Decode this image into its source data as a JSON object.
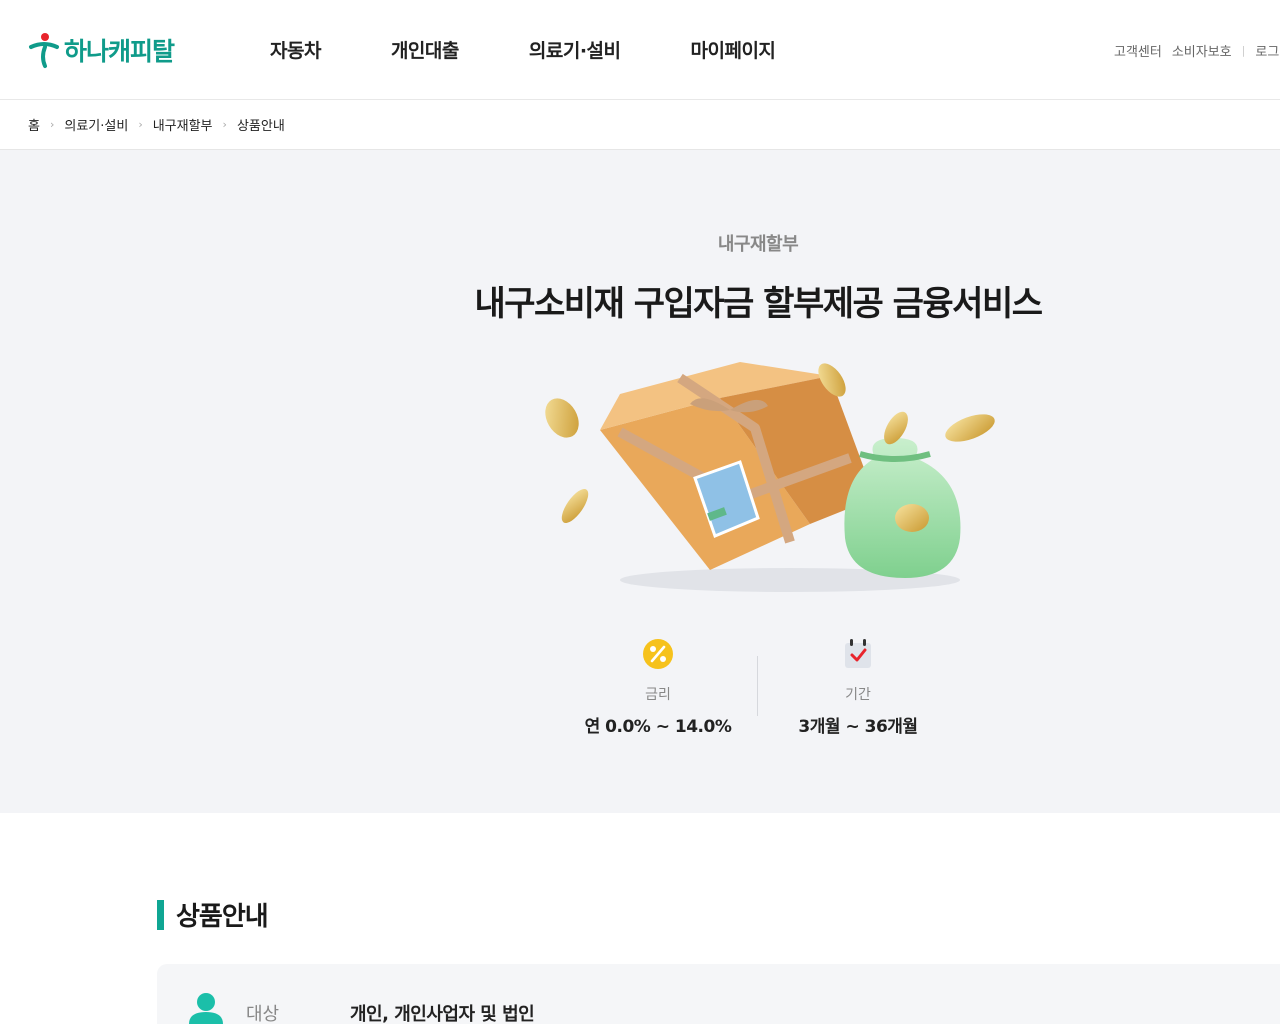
{
  "header": {
    "logo_text": "하나캐피탈",
    "gnb": [
      "자동차",
      "개인대출",
      "의료기·설비",
      "마이페이지"
    ],
    "util": [
      "고객센터",
      "소비자보호",
      "로그"
    ]
  },
  "breadcrumb": [
    "홈",
    "의료기·설비",
    "내구재할부",
    "상품안내"
  ],
  "hero": {
    "subtitle": "내구재할부",
    "title": "내구소비재 구입자금 할부제공 금융서비스",
    "rate_label": "금리",
    "rate_value": "연 0.0% ~ 14.0%",
    "period_label": "기간",
    "period_value": "3개월 ~ 36개월"
  },
  "section": {
    "title": "상품안내",
    "target_label": "대상",
    "target_value": "개인, 개인사업자 및 법인"
  },
  "colors": {
    "brand": "#0f9b8a",
    "accent_bar": "#0fa693",
    "hero_bg": "#f3f4f7",
    "rate_icon": "#f6c21c"
  },
  "icons": {
    "logo": "hana-logo-icon",
    "rate": "percent-icon",
    "period": "calendar-check-icon",
    "target": "person-icon"
  }
}
